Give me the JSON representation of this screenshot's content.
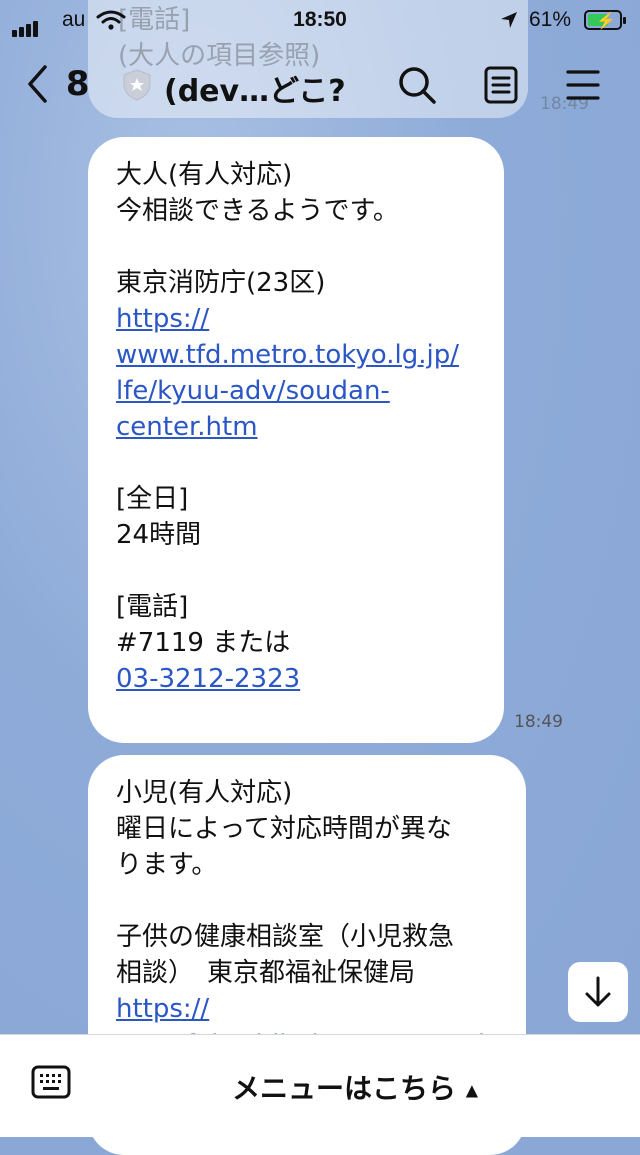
{
  "status_bar": {
    "carrier": "au",
    "time": "18:50",
    "battery": "61%"
  },
  "ghost_message": {
    "line1": "[電話]",
    "line2": "(大人の項目参照)",
    "time": "18:49"
  },
  "header": {
    "back_count": "8",
    "title": "(dev…どこ?"
  },
  "messages": [
    {
      "lines": [
        {
          "text": "大人(有人対応)",
          "link": false
        },
        {
          "text": "今相談できるようです。",
          "link": false
        },
        {
          "text": "",
          "link": false
        },
        {
          "text": "東京消防庁(23区)",
          "link": false
        },
        {
          "text": "https://",
          "link": true
        },
        {
          "text": "www.tfd.metro.tokyo.lg.jp/",
          "link": true
        },
        {
          "text": "lfe/kyuu-adv/soudan-",
          "link": true
        },
        {
          "text": "center.htm",
          "link": true
        },
        {
          "text": "",
          "link": false
        },
        {
          "text": "[全日]",
          "link": false
        },
        {
          "text": "24時間",
          "link": false
        },
        {
          "text": "",
          "link": false
        },
        {
          "text": "[電話]",
          "link": false
        },
        {
          "text": "#7119 または",
          "link": false
        },
        {
          "text": "03-3212-2323",
          "link": true
        }
      ],
      "time": "18:49"
    },
    {
      "lines": [
        {
          "text": "小児(有人対応)",
          "link": false
        },
        {
          "text": "曜日によって対応時間が異な",
          "link": false
        },
        {
          "text": "ります。",
          "link": false
        },
        {
          "text": "",
          "link": false
        },
        {
          "text": "子供の健康相談室（小児救急",
          "link": false
        },
        {
          "text": "相談）　東京都福祉保健局",
          "link": false
        },
        {
          "text": "https://",
          "link": true
        },
        {
          "text": "www.fukushihoken.metro.tok",
          "link": true
        }
      ]
    }
  ],
  "bottom_bar": {
    "menu_label": "メニューはこちら"
  },
  "colors": {
    "link": "#2a56c6",
    "background": "#8eabd8",
    "bubble": "#ffffff"
  }
}
